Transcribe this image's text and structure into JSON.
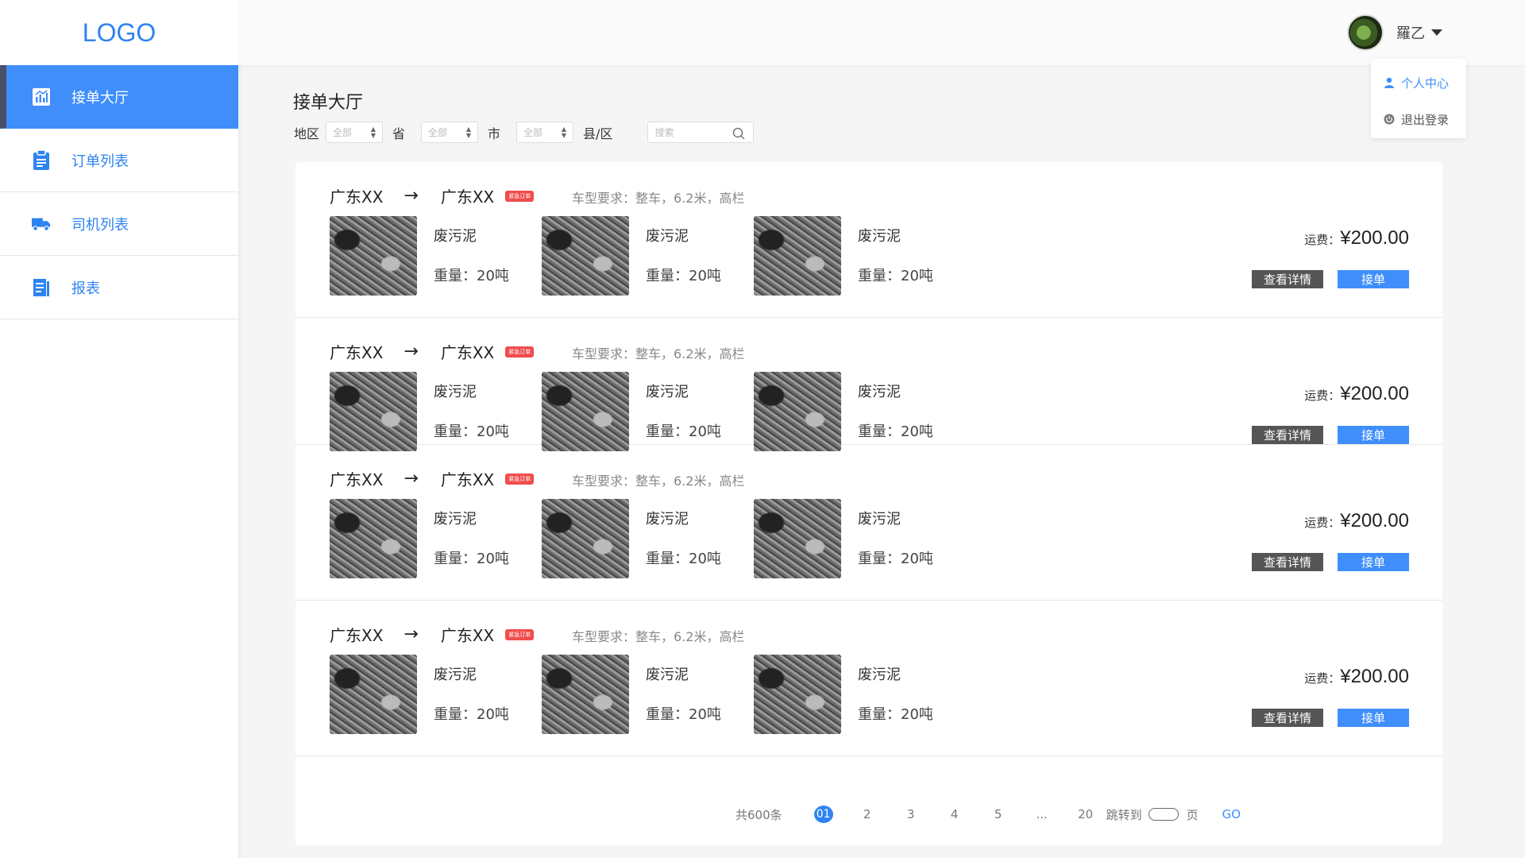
{
  "logo": "LOGO",
  "sidebar": {
    "items": [
      {
        "label": "接单大厅",
        "icon": "chart-icon"
      },
      {
        "label": "订单列表",
        "icon": "clipboard-icon"
      },
      {
        "label": "司机列表",
        "icon": "truck-icon"
      },
      {
        "label": "报表",
        "icon": "report-icon"
      }
    ]
  },
  "user": {
    "name": "羅乙",
    "menu": [
      {
        "label": "个人中心",
        "icon": "user-icon"
      },
      {
        "label": "退出登录",
        "icon": "power-icon"
      }
    ]
  },
  "page_title": "接单大厅",
  "filters": {
    "region_label": "地区",
    "province_label": "省",
    "city_label": "市",
    "county_label": "县/区",
    "province_value": "全部",
    "city_value": "全部",
    "county_value": "全部",
    "search_placeholder": "搜索"
  },
  "orders": [
    {
      "from": "广东XX",
      "arrow": "→",
      "to": "广东XX",
      "badge": "紧急订单",
      "requirement": "车型要求：整车，6.2米，高栏",
      "goods": [
        {
          "name": "废污泥",
          "weight": "重量：20吨"
        },
        {
          "name": "废污泥",
          "weight": "重量：20吨"
        },
        {
          "name": "废污泥",
          "weight": "重量：20吨"
        }
      ],
      "price_label": "运费：",
      "price": "¥200.00",
      "detail_label": "查看详情",
      "take_label": "接单"
    },
    {
      "from": "广东XX",
      "arrow": "→",
      "to": "广东XX",
      "badge": "紧急订单",
      "requirement": "车型要求：整车，6.2米，高栏",
      "goods": [
        {
          "name": "废污泥",
          "weight": "重量：20吨"
        },
        {
          "name": "废污泥",
          "weight": "重量：20吨"
        },
        {
          "name": "废污泥",
          "weight": "重量：20吨"
        }
      ],
      "price_label": "运费：",
      "price": "¥200.00",
      "detail_label": "查看详情",
      "take_label": "接单"
    },
    {
      "from": "广东XX",
      "arrow": "→",
      "to": "广东XX",
      "badge": "紧急订单",
      "requirement": "车型要求：整车，6.2米，高栏",
      "goods": [
        {
          "name": "废污泥",
          "weight": "重量：20吨"
        },
        {
          "name": "废污泥",
          "weight": "重量：20吨"
        },
        {
          "name": "废污泥",
          "weight": "重量：20吨"
        }
      ],
      "price_label": "运费：",
      "price": "¥200.00",
      "detail_label": "查看详情",
      "take_label": "接单"
    },
    {
      "from": "广东XX",
      "arrow": "→",
      "to": "广东XX",
      "badge": "紧急订单",
      "requirement": "车型要求：整车，6.2米，高栏",
      "goods": [
        {
          "name": "废污泥",
          "weight": "重量：20吨"
        },
        {
          "name": "废污泥",
          "weight": "重量：20吨"
        },
        {
          "name": "废污泥",
          "weight": "重量：20吨"
        }
      ],
      "price_label": "运费：",
      "price": "¥200.00",
      "detail_label": "查看详情",
      "take_label": "接单"
    }
  ],
  "pagination": {
    "total": "共600条",
    "pages": [
      "01",
      "2",
      "3",
      "4",
      "5",
      "...",
      "20"
    ],
    "current": "01",
    "jump_label": "跳转到",
    "page_unit": "页",
    "go_label": "GO"
  },
  "colors": {
    "accent": "#3f8efc",
    "badge": "#f04d4d",
    "detail_button": "#555555"
  }
}
